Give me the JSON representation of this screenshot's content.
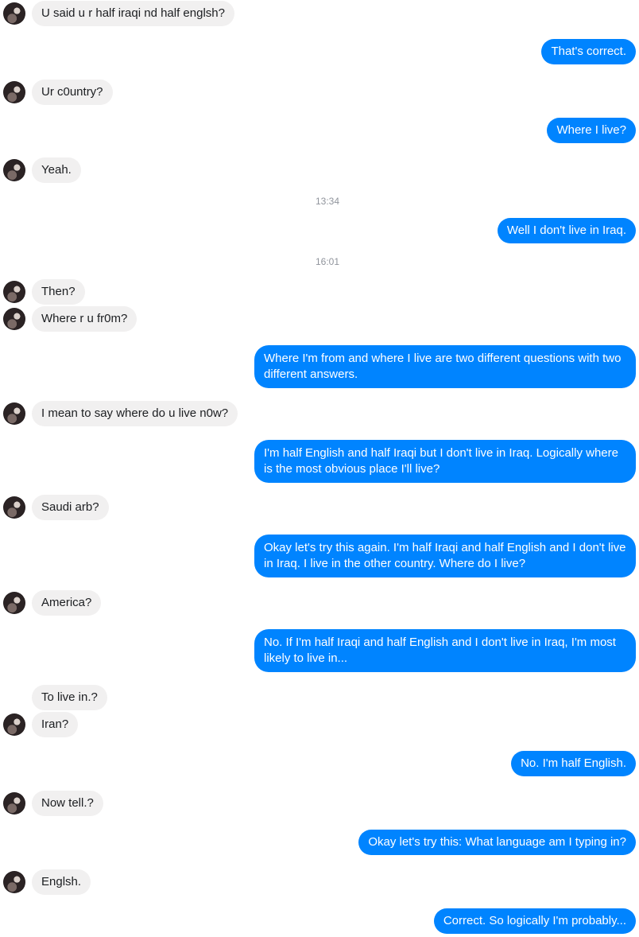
{
  "messages": [
    {
      "dir": "in",
      "text": "U said u r half iraqi nd half englsh?",
      "avatar": true
    },
    {
      "dir": "out",
      "text": "That's correct."
    },
    {
      "dir": "in",
      "text": "Ur c0untry?",
      "avatar": true
    },
    {
      "dir": "out",
      "text": "Where I live?"
    },
    {
      "dir": "in",
      "text": "Yeah.",
      "avatar": true
    },
    {
      "dir": "time",
      "text": "13:34"
    },
    {
      "dir": "out",
      "text": "Well I don't live in Iraq."
    },
    {
      "dir": "time",
      "text": "16:01"
    },
    {
      "dir": "in",
      "text": "Then?",
      "avatar": true
    },
    {
      "dir": "in",
      "text": "Where r u fr0m?",
      "avatar": true
    },
    {
      "dir": "out",
      "text": "Where I'm from and where I live are two different questions with two different answers."
    },
    {
      "dir": "in",
      "text": "I mean to say where do u live n0w?",
      "avatar": true
    },
    {
      "dir": "out",
      "text": "I'm half English and half Iraqi but I don't live in Iraq. Logically where is the most obvious place I'll live?"
    },
    {
      "dir": "in",
      "text": "Saudi arb?",
      "avatar": true
    },
    {
      "dir": "out",
      "text": "Okay let's try this again. I'm half Iraqi and half English and I don't live in Iraq. I live in the other country. Where do I live?"
    },
    {
      "dir": "in",
      "text": "America?",
      "avatar": true
    },
    {
      "dir": "out",
      "text": "No. If I'm half Iraqi and half English and I don't live in Iraq, I'm most likely to live in..."
    },
    {
      "dir": "in",
      "text": "To live in.?",
      "avatar": false
    },
    {
      "dir": "in",
      "text": "Iran?",
      "avatar": true
    },
    {
      "dir": "out",
      "text": "No. I'm half English."
    },
    {
      "dir": "in",
      "text": "Now tell.?",
      "avatar": true
    },
    {
      "dir": "out",
      "text": "Okay let's try this: What language am I typing in?"
    },
    {
      "dir": "in",
      "text": "Englsh.",
      "avatar": true
    },
    {
      "dir": "out",
      "text": "Correct. So logically I'm probably..."
    }
  ],
  "colors": {
    "outgoing": "#0084ff",
    "incoming": "#f1f0f0",
    "timestamp": "#90949c"
  }
}
